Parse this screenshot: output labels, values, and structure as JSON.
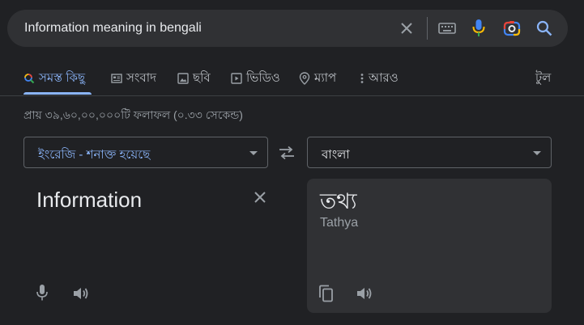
{
  "search": {
    "query": "Information meaning in bengali"
  },
  "search_icons": [
    "close-icon",
    "keyboard-icon",
    "mic-icon",
    "lens-icon",
    "search-icon"
  ],
  "tabs": [
    {
      "label": "সমস্ত কিছু",
      "icon": "search-icon",
      "selected": true
    },
    {
      "label": "সংবাদ",
      "icon": "news-icon"
    },
    {
      "label": "ছবি",
      "icon": "image-icon"
    },
    {
      "label": "ভিডিও",
      "icon": "video-icon"
    },
    {
      "label": "ম্যাপ",
      "icon": "map-pin-icon"
    },
    {
      "label": "আরও",
      "icon": "more-vert-icon"
    }
  ],
  "tools_label": "টুল",
  "result_stats": "প্রায় ৩৯,৬০,০০,০০০টি ফলাফল (০.৩৩ সেকেন্ড)",
  "translator": {
    "source_language": "ইংরেজি - শনাক্ত হয়েছে",
    "target_language": "বাংলা",
    "source_text": "Information",
    "target_text": "তথ্য",
    "transliteration": "Tathya"
  },
  "colors": {
    "background": "#202124",
    "accent": "#8ab4f8",
    "panel": "#303134"
  }
}
